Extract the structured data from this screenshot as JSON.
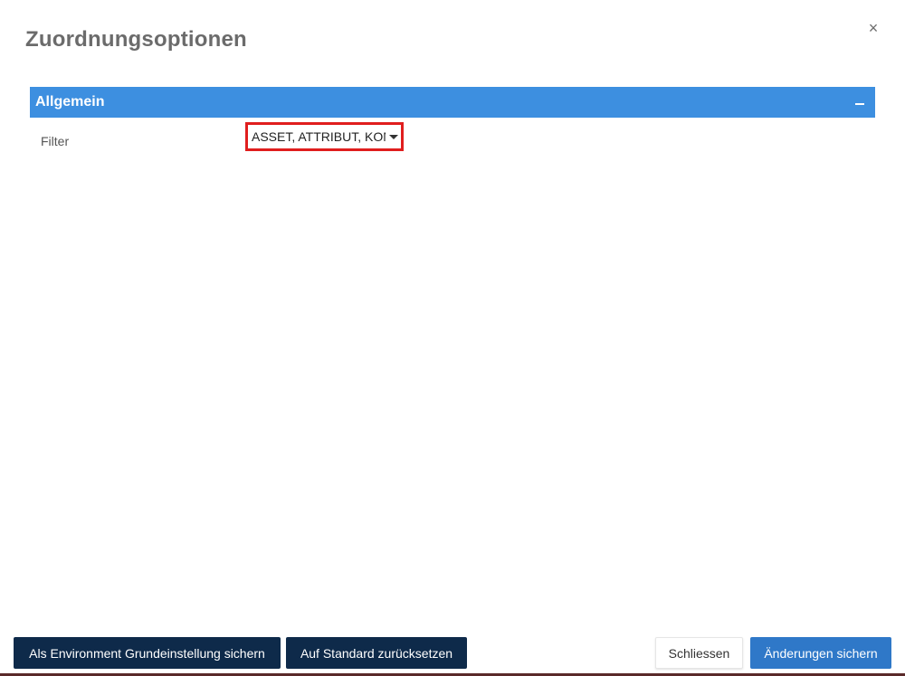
{
  "dialog": {
    "title": "Zuordnungsoptionen",
    "close_glyph": "×"
  },
  "section": {
    "title": "Allgemein",
    "collapse_icon": "minus-icon",
    "fields": [
      {
        "label": "Filter",
        "value": "ASSET, ATTRIBUT, KON"
      }
    ]
  },
  "footer": {
    "save_as_environment_default": "Als Environment Grundeinstellung sichern",
    "reset_to_default": "Auf Standard zurücksetzen",
    "close": "Schliessen",
    "save_changes": "Änderungen sichern"
  },
  "colors": {
    "section_header": "#3d8fe0",
    "dark_button": "#0e2a4a",
    "primary_button": "#2f78c8",
    "highlight_border": "#e01e1e"
  }
}
